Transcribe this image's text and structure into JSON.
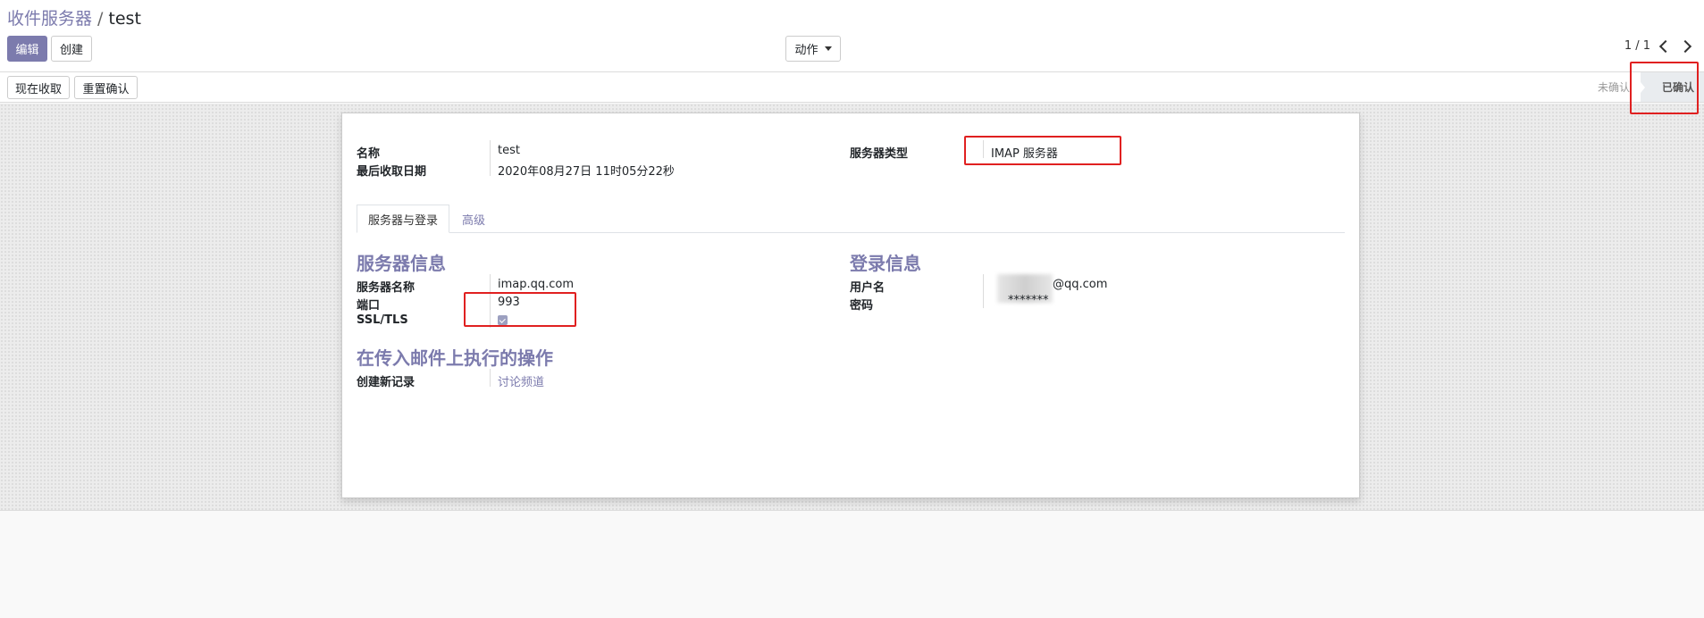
{
  "breadcrumb": {
    "parent": "收件服务器",
    "separator": "/",
    "current": "test"
  },
  "toolbar": {
    "edit_label": "编辑",
    "create_label": "创建",
    "action_label": "动作"
  },
  "pager": {
    "value": "1 / 1"
  },
  "statusbar": {
    "fetch_now_label": "现在收取",
    "reset_label": "重置确认",
    "stages": [
      {
        "label": "未确认"
      },
      {
        "label": "已确认"
      }
    ]
  },
  "form": {
    "name_label": "名称",
    "name_value": "test",
    "last_fetch_label": "最后收取日期",
    "last_fetch_value": "2020年08月27日 11时05分22秒",
    "server_type_label": "服务器类型",
    "server_type_value": "IMAP 服务器",
    "tabs": [
      {
        "label": "服务器与登录"
      },
      {
        "label": "高级"
      }
    ],
    "server_info_title": "服务器信息",
    "server_name_label": "服务器名称",
    "server_name_value": "imap.qq.com",
    "port_label": "端口",
    "port_value": "993",
    "ssl_label": "SSL/TLS",
    "login_info_title": "登录信息",
    "username_label": "用户名",
    "username_value": "@qq.com",
    "password_label": "密码",
    "password_value": "*******",
    "actions_title": "在传入邮件上执行的操作",
    "create_record_label": "创建新记录",
    "create_record_value": "讨论频道"
  },
  "colors": {
    "accent": "#7c7bad",
    "highlight_box": "#e02020"
  }
}
